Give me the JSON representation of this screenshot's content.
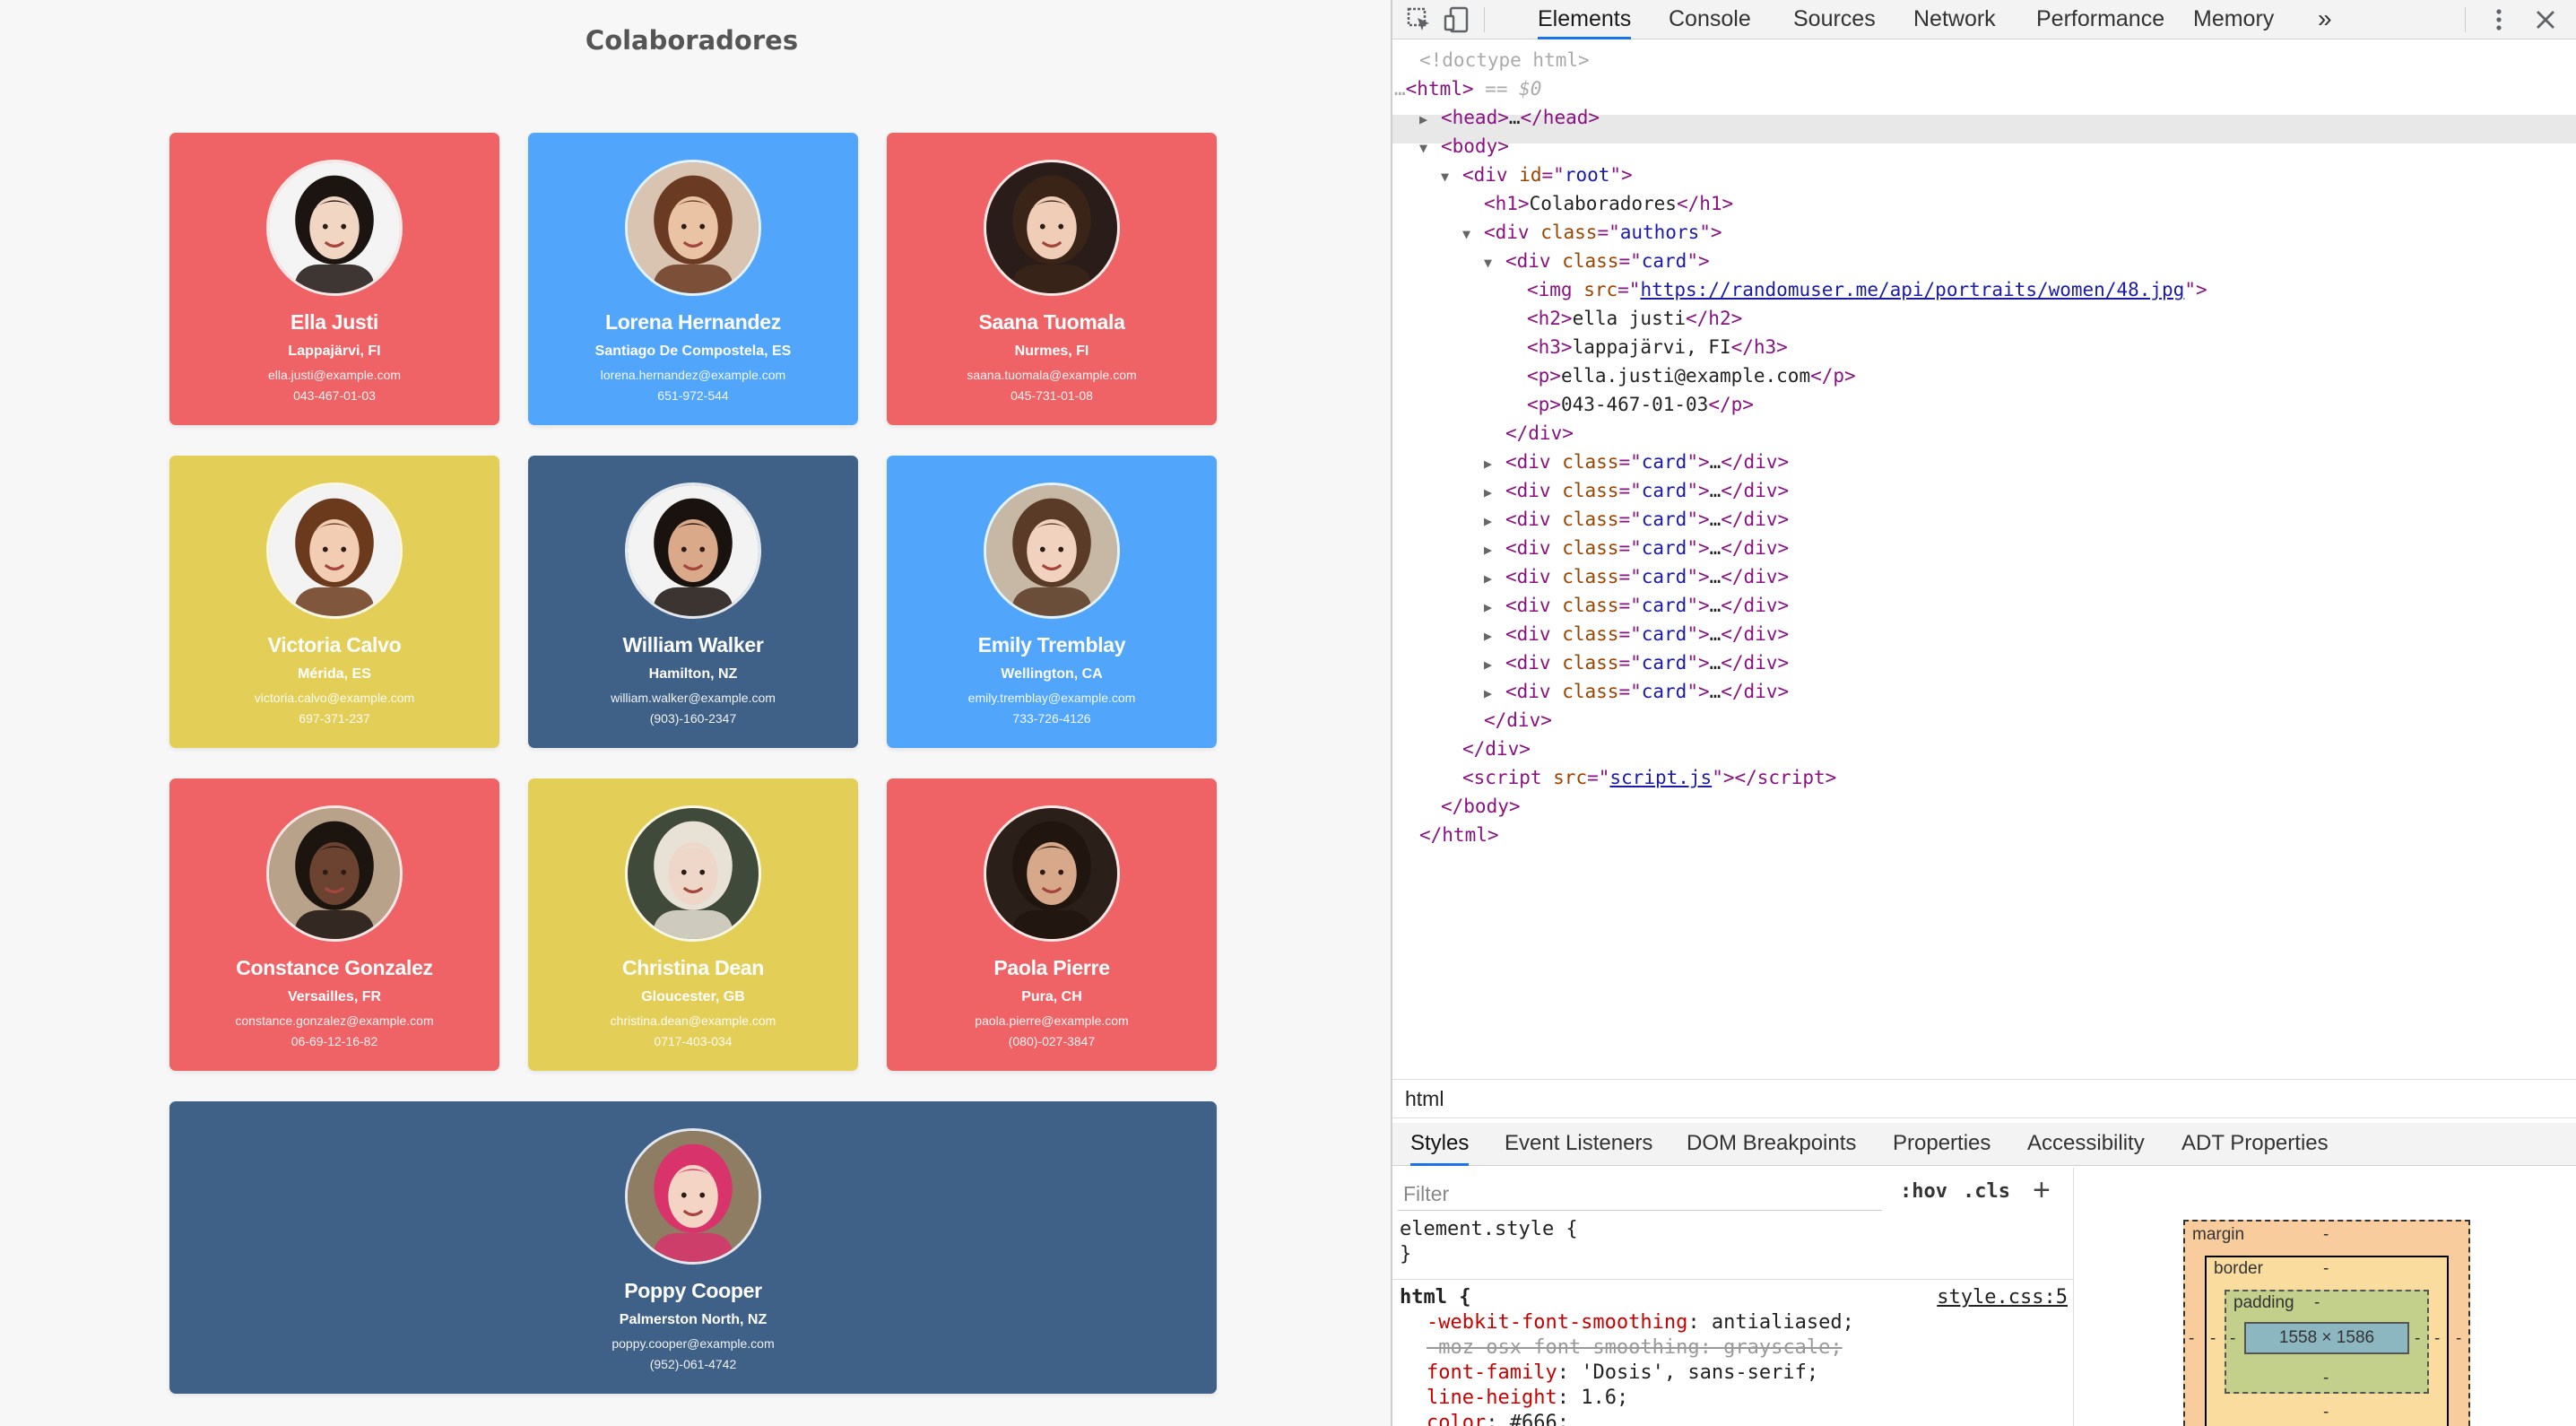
{
  "page": {
    "title": "Colaboradores",
    "cards": [
      {
        "name": "Ella Justi",
        "location": "Lappajärvi, FI",
        "email": "ella.justi@example.com",
        "phone": "043-467-01-03",
        "color": "#ef6366"
      },
      {
        "name": "Lorena Hernandez",
        "location": "Santiago De Compostela, ES",
        "email": "lorena.hernandez@example.com",
        "phone": "651-972-544",
        "color": "#51a6fb"
      },
      {
        "name": "Saana Tuomala",
        "location": "Nurmes, FI",
        "email": "saana.tuomala@example.com",
        "phone": "045-731-01-08",
        "color": "#ef6366"
      },
      {
        "name": "Victoria Calvo",
        "location": "Mérida, ES",
        "email": "victoria.calvo@example.com",
        "phone": "697-371-237",
        "color": "#e3cf58"
      },
      {
        "name": "William Walker",
        "location": "Hamilton, NZ",
        "email": "william.walker@example.com",
        "phone": "(903)-160-2347",
        "color": "#3f6087"
      },
      {
        "name": "Emily Tremblay",
        "location": "Wellington, CA",
        "email": "emily.tremblay@example.com",
        "phone": "733-726-4126",
        "color": "#51a6fb"
      },
      {
        "name": "Constance Gonzalez",
        "location": "Versailles, FR",
        "email": "constance.gonzalez@example.com",
        "phone": "06-69-12-16-82",
        "color": "#ef6366"
      },
      {
        "name": "Christina Dean",
        "location": "Gloucester, GB",
        "email": "christina.dean@example.com",
        "phone": "0717-403-034",
        "color": "#e3cf58"
      },
      {
        "name": "Paola Pierre",
        "location": "Pura, CH",
        "email": "paola.pierre@example.com",
        "phone": "(080)-027-3847",
        "color": "#ef6366"
      },
      {
        "name": "Poppy Cooper",
        "location": "Palmerston North, NZ",
        "email": "poppy.cooper@example.com",
        "phone": "(952)-061-4742",
        "color": "#3f6087"
      }
    ]
  },
  "devtools": {
    "tabs": [
      "Elements",
      "Console",
      "Sources",
      "Network",
      "Performance",
      "Memory"
    ],
    "active_tab": "Elements",
    "more_tabs": "»",
    "breadcrumb": "html",
    "subtabs": [
      "Styles",
      "Event Listeners",
      "DOM Breakpoints",
      "Properties",
      "Accessibility",
      "ADT Properties"
    ],
    "filter_placeholder": "Filter",
    "hov": ":hov",
    "cls": ".cls",
    "dom": {
      "doctype": "<!doctype html>",
      "html_open": "<html>",
      "selected_marker": "== $0",
      "head_collapsed": "…",
      "root_id": "root",
      "h1_text": "Colaboradores",
      "authors_class": "authors",
      "card_class": "card",
      "img_src": "https://randomuser.me/api/portraits/women/48.jpg",
      "h2_text": "ella justi",
      "h3_text": "lappajärvi, FI",
      "p1_text": "ella.justi@example.com",
      "p2_text": "043-467-01-03",
      "script_src": "script.js",
      "collapsed_cards": 9
    },
    "styles": {
      "element_style": "element.style {",
      "close_brace": "}",
      "html_rule": "html {",
      "source": "style.css:5",
      "decls": [
        {
          "prop": "-webkit-font-smoothing",
          "value": "antialiased;",
          "struck": false
        },
        {
          "prop": "-moz-osx-font-smoothing",
          "value": "grayscale;",
          "struck": true
        },
        {
          "prop": "font-family",
          "value": "'Dosis', sans-serif;",
          "struck": false
        },
        {
          "prop": "line-height",
          "value": "1.6;",
          "struck": false
        },
        {
          "prop": "color",
          "value": "#666;",
          "struck": false
        }
      ]
    },
    "box_model": {
      "margin": "margin",
      "border": "border",
      "padding": "padding",
      "dash": "-",
      "content": "1558 × 1586"
    }
  }
}
